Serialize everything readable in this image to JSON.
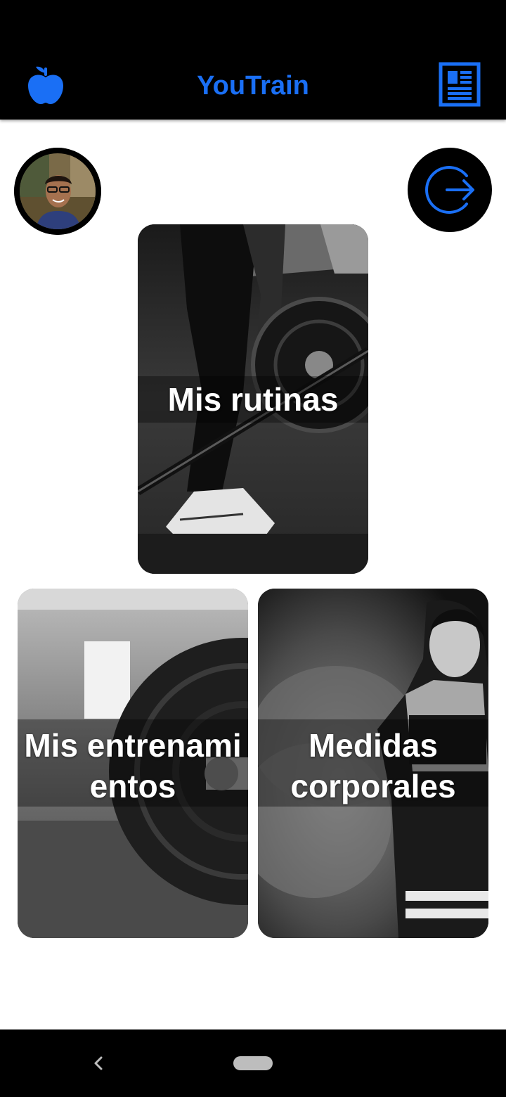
{
  "app": {
    "title": "YouTrain"
  },
  "header": {
    "left_icon": "apple-icon",
    "right_icon": "newspaper-icon",
    "accent_color": "#1a6ff5"
  },
  "profile": {
    "avatar_icon": "user-avatar",
    "logout_icon": "logout-icon"
  },
  "cards": {
    "routines": {
      "label": "Mis rutinas"
    },
    "workouts": {
      "label": "Mis entrenami\nentos"
    },
    "measures": {
      "label": "Medidas\ncorporales"
    }
  },
  "system_nav": {
    "back_icon": "back-chevron-icon",
    "home_icon": "home-pill-icon"
  }
}
